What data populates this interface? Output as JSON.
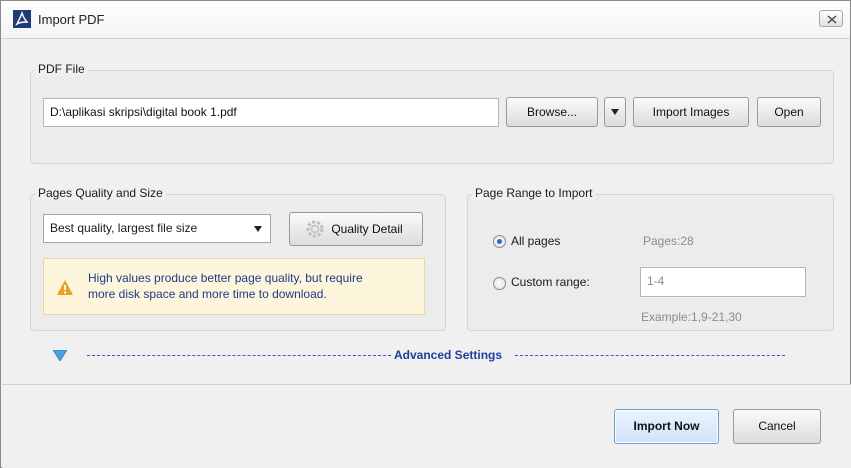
{
  "window": {
    "title": "Import PDF",
    "close_label": "X"
  },
  "pdf_file": {
    "group_title": "PDF File",
    "path_value": "D:\\aplikasi skripsi\\digital book 1.pdf",
    "browse_label": "Browse...",
    "import_images_label": "Import Images",
    "open_label": "Open"
  },
  "quality": {
    "group_title": "Pages Quality and Size",
    "selected_option": "Best quality, largest file size",
    "quality_detail_label": "Quality Detail",
    "warning_line1": "High values produce better page quality, but require",
    "warning_line2": "more disk space and more time to download."
  },
  "page_range": {
    "group_title": "Page Range to Import",
    "all_pages_label": "All pages",
    "pages_info": "Pages:28",
    "custom_range_label": "Custom range:",
    "custom_range_value": "1-4",
    "example_text": "Example:1,9-21,30",
    "selected": "all"
  },
  "advanced": {
    "label": "Advanced Settings"
  },
  "actions": {
    "import_now_label": "Import Now",
    "cancel_label": "Cancel"
  },
  "colors": {
    "accent": "#2a6ad1",
    "advanced_link": "#1f3f9e",
    "warning_bg": "#fdf6dc",
    "warning_icon": "#f0a020"
  },
  "icons": {
    "app": "pdf-app-icon",
    "close": "close-icon",
    "dropdown": "chevron-down-icon",
    "quality_detail": "gear-icon",
    "warning": "warning-icon",
    "advanced_toggle": "triangle-down-icon"
  }
}
